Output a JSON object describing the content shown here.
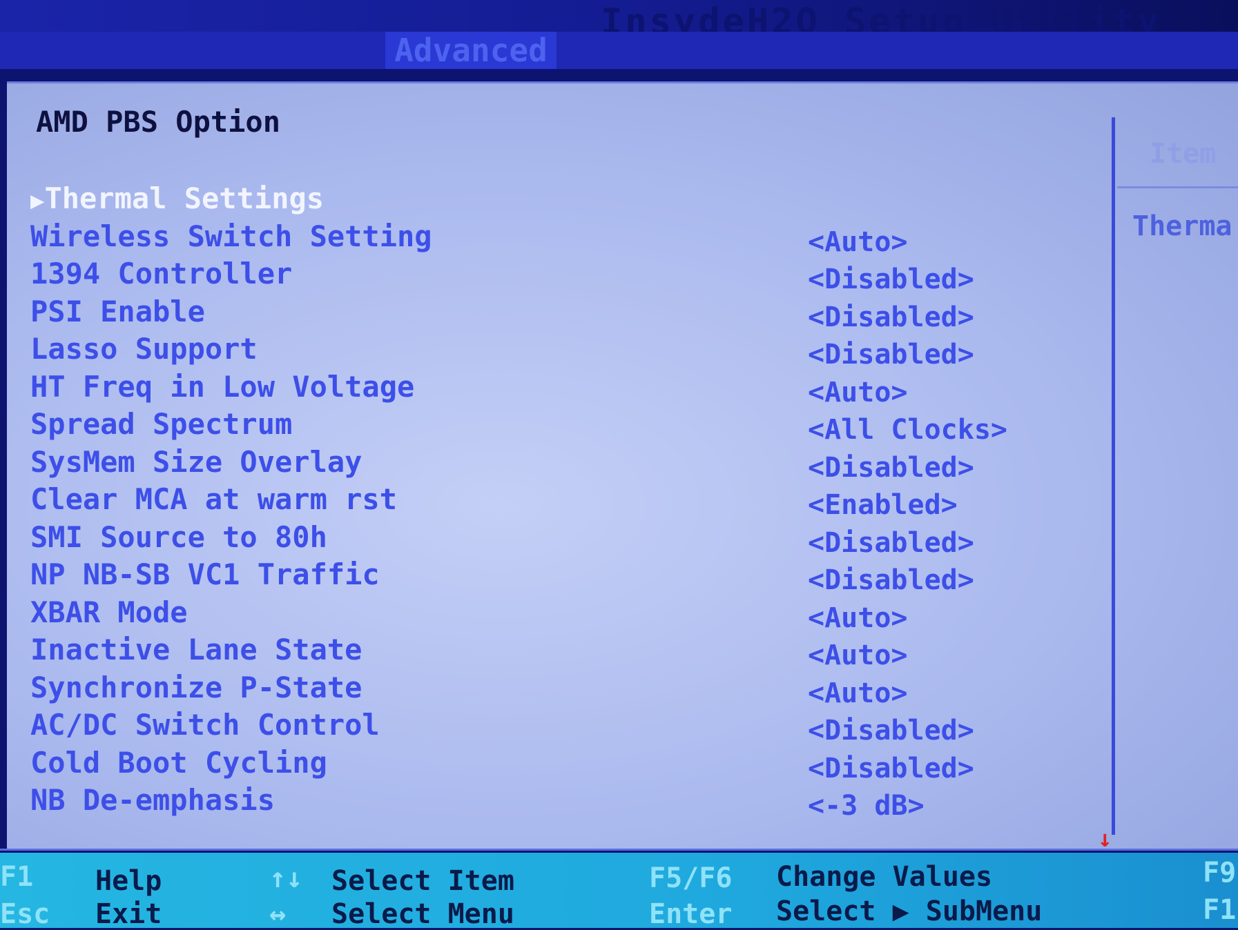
{
  "app_title": "InsydeH2O Setup Utility",
  "active_tab": "Advanced",
  "page_title": "AMD PBS Option",
  "help_panel": {
    "title": "Item",
    "text": "Therma"
  },
  "settings": [
    {
      "label": "Thermal Settings",
      "value": "",
      "selected": true,
      "submenu": true
    },
    {
      "label": "Wireless Switch Setting",
      "value": "<Auto>"
    },
    {
      "label": "1394 Controller",
      "value": "<Disabled>"
    },
    {
      "label": "PSI Enable",
      "value": "<Disabled>"
    },
    {
      "label": "Lasso Support",
      "value": "<Disabled>"
    },
    {
      "label": "HT Freq in Low Voltage",
      "value": "<Auto>"
    },
    {
      "label": "Spread Spectrum",
      "value": "<All Clocks>"
    },
    {
      "label": "SysMem Size Overlay",
      "value": "<Disabled>"
    },
    {
      "label": "Clear MCA at warm rst",
      "value": "<Enabled>"
    },
    {
      "label": "SMI Source to 80h",
      "value": "<Disabled>"
    },
    {
      "label": "NP NB-SB VC1 Traffic",
      "value": "<Disabled>"
    },
    {
      "label": "XBAR Mode",
      "value": "<Auto>"
    },
    {
      "label": "Inactive Lane State",
      "value": "<Auto>"
    },
    {
      "label": "Synchronize P-State",
      "value": "<Auto>"
    },
    {
      "label": "AC/DC Switch Control",
      "value": "<Disabled>"
    },
    {
      "label": "Cold Boot Cycling",
      "value": "<Disabled>"
    },
    {
      "label": "NB De-emphasis",
      "value": "<-3 dB>"
    }
  ],
  "footer": {
    "f1_key": "F1",
    "f1_desc": "Help",
    "esc_key": "Esc",
    "esc_desc": "Exit",
    "updown_key": "↑↓",
    "updown_desc": "Select Item",
    "leftright_key": "↔",
    "leftright_desc": "Select Menu",
    "f5f6_key": "F5/F6",
    "f5f6_desc": "Change Values",
    "enter_key": "Enter",
    "enter_desc": "Select ▶ SubMenu",
    "f9_key": "F9",
    "f10_key": "F1"
  },
  "colors": {
    "item_text": "#3d4fe8",
    "selected_text": "#f2f4ff",
    "footer_bg": "#25b6e2",
    "tab_bg": "#1e28b4"
  }
}
